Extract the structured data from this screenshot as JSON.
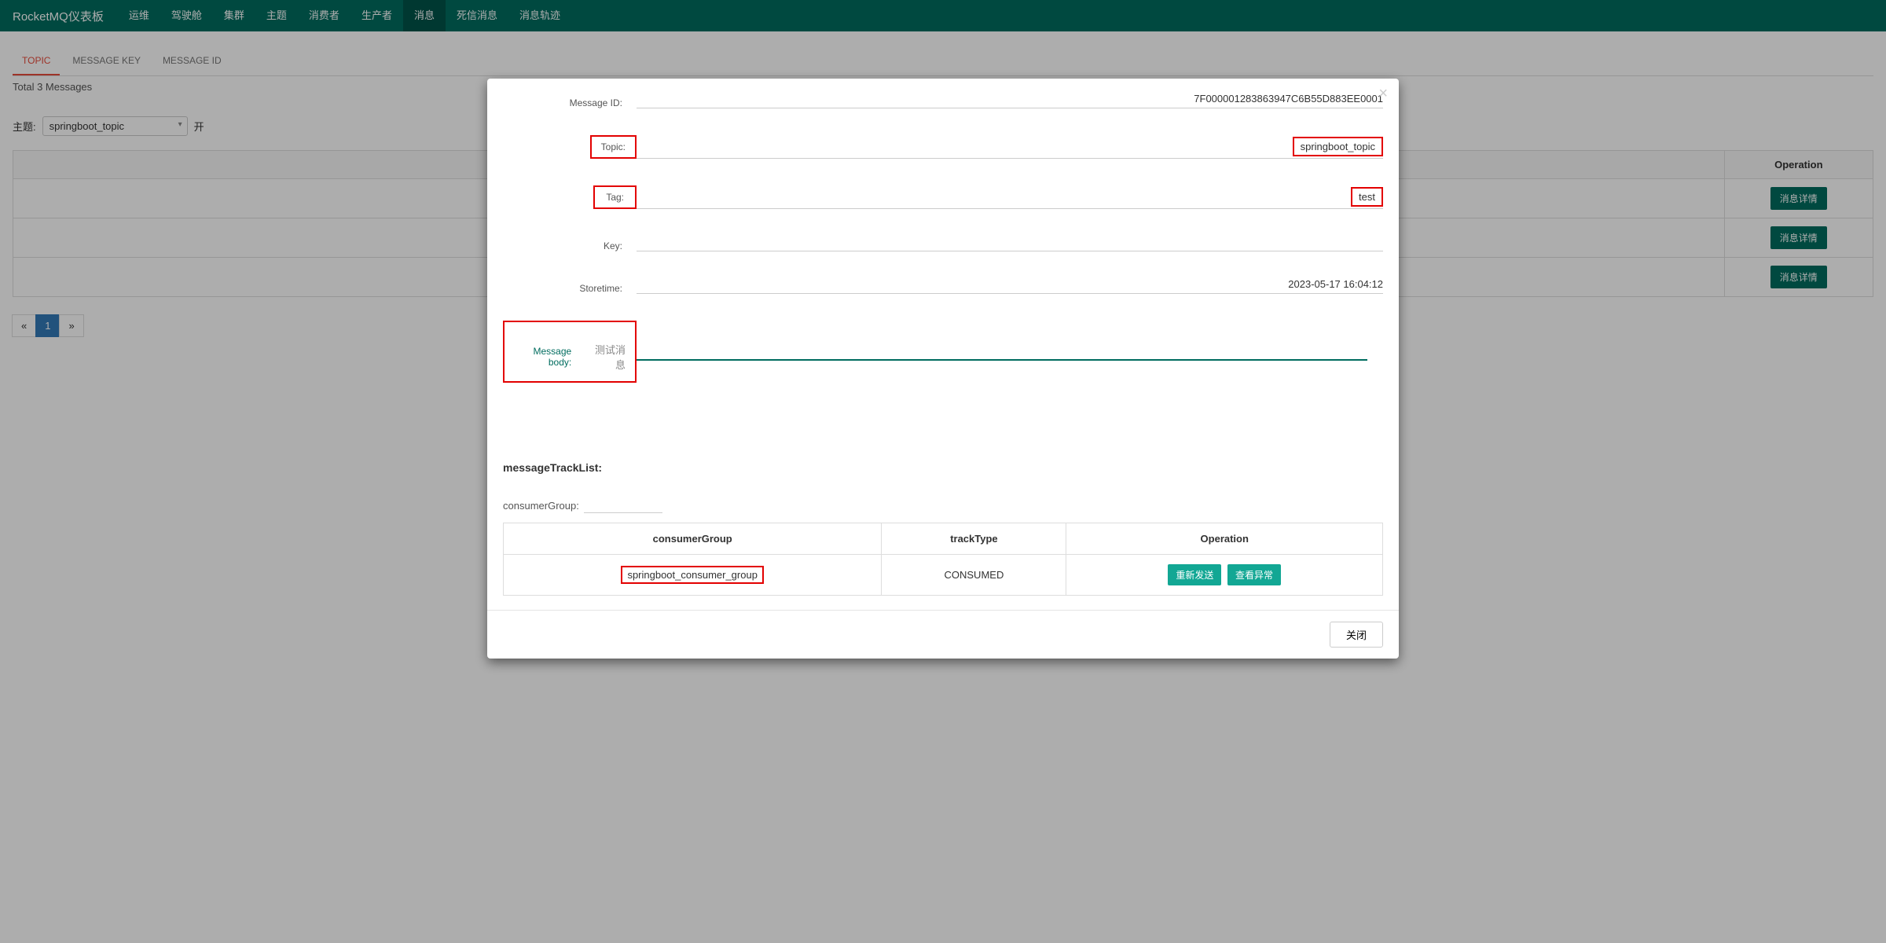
{
  "navbar": {
    "brand": "RocketMQ仪表板",
    "items": [
      "运维",
      "驾驶舱",
      "集群",
      "主题",
      "消费者",
      "生产者",
      "消息",
      "死信消息",
      "消息轨迹"
    ],
    "active_index": 6
  },
  "tabs": {
    "items": [
      "TOPIC",
      "MESSAGE KEY",
      "MESSAGE ID"
    ],
    "active_index": 0
  },
  "total_label": "Total 3 Messages",
  "filter": {
    "topic_label": "主题:",
    "topic_value": "springboot_topic",
    "begin_marker": "开"
  },
  "bg_table": {
    "op_header": "Operation",
    "detail_btn": "消息详情",
    "rows": 3
  },
  "pagination": {
    "prev": "«",
    "pages": [
      "1"
    ],
    "next": "»",
    "active": "1"
  },
  "modal": {
    "close_icon": "×",
    "fields": {
      "message_id_label": "Message ID:",
      "message_id_value": "7F000001283863947C6B55D883EE0001",
      "topic_label": "Topic:",
      "topic_value": "springboot_topic",
      "tag_label": "Tag:",
      "tag_value": "test",
      "key_label": "Key:",
      "key_value": "",
      "storetime_label": "Storetime:",
      "storetime_value": "2023-05-17 16:04:12",
      "body_label": "Message body:",
      "body_value": "测试消息"
    },
    "track": {
      "title": "messageTrackList:",
      "cg_label": "consumerGroup:",
      "headers": [
        "consumerGroup",
        "trackType",
        "Operation"
      ],
      "row": {
        "consumerGroup": "springboot_consumer_group",
        "trackType": "CONSUMED",
        "resend_btn": "重新发送",
        "exception_btn": "查看异常"
      }
    },
    "close_btn": "关闭"
  }
}
